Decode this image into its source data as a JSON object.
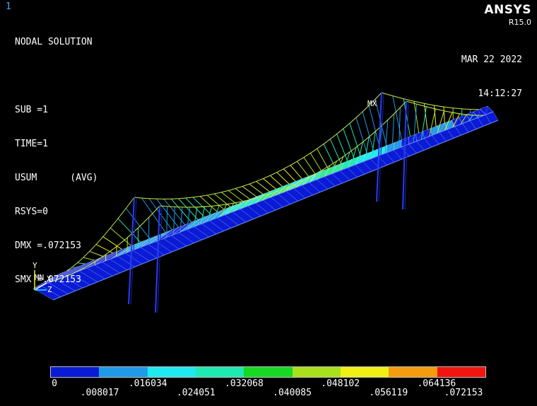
{
  "window_number": "1",
  "info_lines": [
    "NODAL SOLUTION",
    "",
    "SUB =1",
    "TIME=1",
    "USUM      (AVG)",
    "RSYS=0",
    "DMX =.072153",
    "SMX =.072153"
  ],
  "brand": {
    "name": "ANSYS",
    "version": "R15.0"
  },
  "date": "MAR 22 2022",
  "time": "14:12:27",
  "markers": {
    "max": "MX",
    "min": "MN"
  },
  "triad": {
    "y": "Y",
    "x": "X",
    "z": "Z"
  },
  "legend": {
    "colors": [
      "#0a1bd6",
      "#1f9ae8",
      "#1ee8f0",
      "#1de9b0",
      "#17d923",
      "#a8e01c",
      "#f0f012",
      "#f59b0e",
      "#f2150f"
    ],
    "labels": [
      "0",
      ".008017",
      ".016034",
      ".024051",
      ".032068",
      ".040085",
      ".048102",
      ".056119",
      ".064136",
      ".072153"
    ]
  }
}
